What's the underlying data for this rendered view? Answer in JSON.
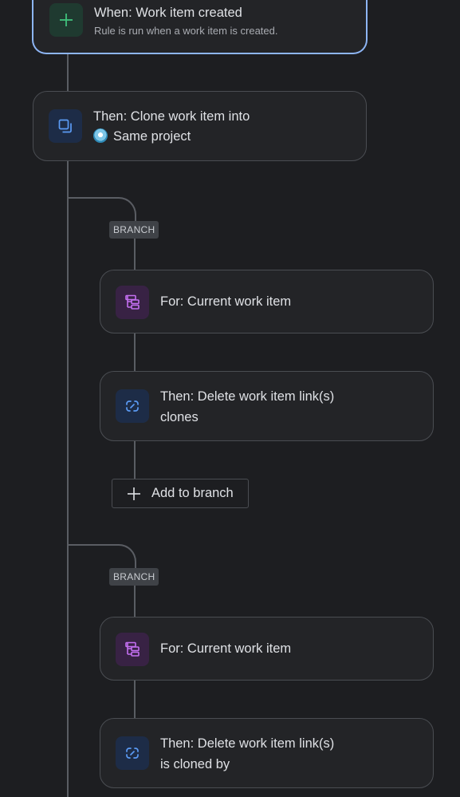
{
  "trigger": {
    "title": "When: Work item created",
    "subtitle": "Rule is run when a work item is created.",
    "icon": "plus-icon",
    "accent": "#8db5f4"
  },
  "clone_action": {
    "title": "Then: Clone work item into",
    "project": "Same project",
    "icon": "clone-icon"
  },
  "branches": [
    {
      "badge": "BRANCH",
      "for_label": "For: Current work item",
      "action_title": "Then: Delete work item link(s)",
      "action_detail": "clones",
      "add_label": "Add to branch"
    },
    {
      "badge": "BRANCH",
      "for_label": "For: Current work item",
      "action_title": "Then: Delete work item link(s)",
      "action_detail": "is cloned by"
    }
  ],
  "colors": {
    "background": "#1d1e21",
    "card": "#232427",
    "green_icon": "#3fc17c",
    "blue_icon": "#5b9bf5",
    "purple_icon": "#c36ff0"
  }
}
